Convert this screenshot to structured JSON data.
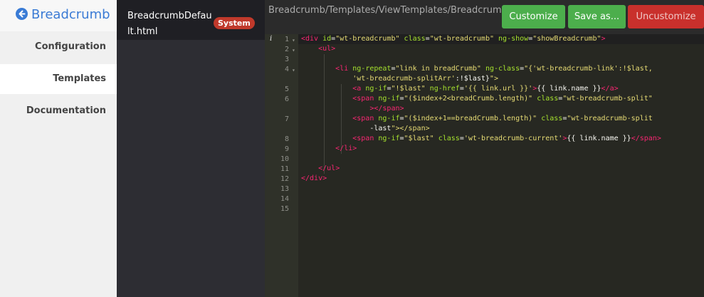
{
  "nav": {
    "title": "Breadcrumb",
    "back_icon": "arrow-left-circle-icon",
    "items": [
      {
        "label": "Configuration",
        "active": false
      },
      {
        "label": "Templates",
        "active": true
      },
      {
        "label": "Documentation",
        "active": false
      }
    ]
  },
  "files": [
    {
      "name": "BreadcrumbDefault.html",
      "badge": "System"
    }
  ],
  "editor": {
    "path": "Breadcrumb/Templates/ViewTemplates/BreadcrumbDefault.html",
    "buttons": {
      "customize": "Customize",
      "save_as": "Save as...",
      "uncustomize": "Uncustomize"
    },
    "info_marker": "i",
    "line_numbers": [
      "1",
      "2",
      "3",
      "4",
      "5",
      "6",
      "7",
      "8",
      "9",
      "10",
      "11",
      "12",
      "13",
      "14",
      "15"
    ],
    "lines": [
      "<div id=\"wt-breadcrumb\" class=\"wt-breadcrumb\" ng-show=\"showBreadcrumb\">",
      "    <ul>",
      "",
      "        <li ng-repeat=\"link in breadCrumb\" ng-class=\"{'wt-breadcrumb-link':!$last,",
      "            'wt-breadcrumb-splitArr':!$last}\">",
      "            <a ng-if=\"!$last\" ng-href='{{ link.url }}'>{{ link.name }}</a>",
      "            <span ng-if=\"($index+2<breadCrumb.length)\" class=\"wt-breadcrumb-split\"",
      "                ></span>",
      "            <span ng-if=\"($index+1==breadCrumb.length)\" class=\"wt-breadcrumb-split",
      "                -last\"></span>",
      "            <span ng-if=\"$last\" class='wt-breadcrumb-current'>{{ link.name }}</span>",
      "        </li>",
      "",
      "    </ul>",
      "</div>",
      "",
      "",
      ""
    ]
  },
  "colors": {
    "accent": "#3a7bd5",
    "success": "#4cae4c",
    "danger": "#c9302c",
    "badge": "#c0392b"
  }
}
